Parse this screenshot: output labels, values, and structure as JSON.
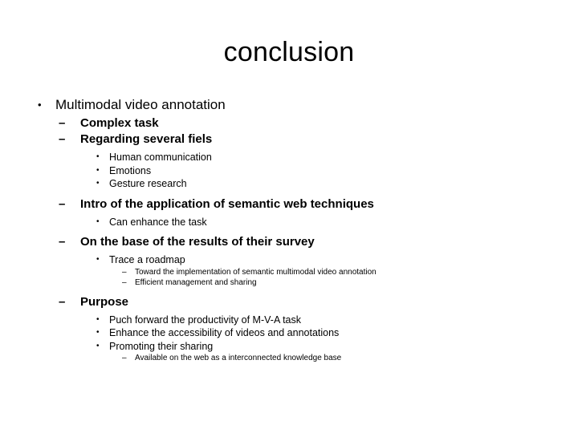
{
  "slide": {
    "title": "conclusion",
    "bullet_glyph_large": "•",
    "bullet_glyph_small": "•",
    "dash_glyph": "–",
    "outline": [
      {
        "level": 1,
        "text": "Multimodal video annotation"
      },
      {
        "level": 2,
        "text": "Complex task"
      },
      {
        "level": 2,
        "text": "Regarding several fiels"
      },
      {
        "level": 3,
        "text": "Human communication"
      },
      {
        "level": 3,
        "text": "Emotions"
      },
      {
        "level": 3,
        "text": "Gesture research"
      },
      {
        "level": 2,
        "text": "Intro of the application of semantic web techniques"
      },
      {
        "level": 3,
        "text": "Can enhance the task"
      },
      {
        "level": 2,
        "text": "On the base of the results of their survey"
      },
      {
        "level": 3,
        "text": "Trace a roadmap"
      },
      {
        "level": 4,
        "text": "Toward the implementation of semantic multimodal video annotation"
      },
      {
        "level": 4,
        "text": "Efficient management and sharing"
      },
      {
        "level": 2,
        "text": "Purpose"
      },
      {
        "level": 3,
        "text": "Puch forward the productivity of M-V-A task"
      },
      {
        "level": 3,
        "text": "Enhance the accessibility of videos and annotations"
      },
      {
        "level": 3,
        "text": "Promoting their sharing"
      },
      {
        "level": 4,
        "text": "Available on the web as a interconnected knowledge base"
      }
    ]
  },
  "colors": {
    "background": "#ffffff",
    "text": "#000000"
  }
}
